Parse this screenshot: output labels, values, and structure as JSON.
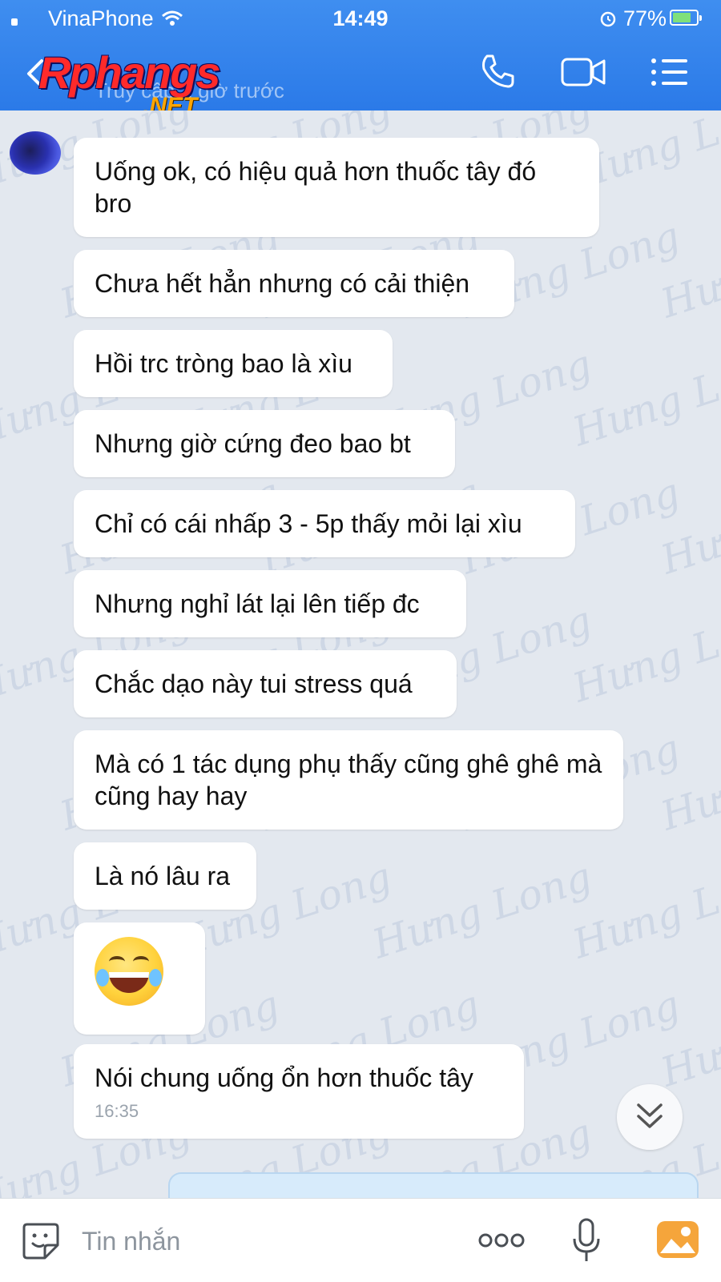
{
  "status_bar": {
    "carrier": "VinaPhone",
    "time": "14:49",
    "battery": "77%",
    "battery_level": 0.77
  },
  "header": {
    "logo_main": "Rphangs",
    "logo_sub": ".NET",
    "subtitle": "Truy cập 1 giờ trước",
    "icons": [
      "back-icon",
      "call-icon",
      "video-call-icon",
      "menu-icon"
    ]
  },
  "messages": [
    {
      "text": "Uống ok, có hiệu quả hơn thuốc tây đó bro"
    },
    {
      "text": "Chưa hết hẳn nhưng có cải thiện"
    },
    {
      "text": "Hồi trc tròng bao là xìu"
    },
    {
      "text": "Nhưng giờ cứng đeo bao bt"
    },
    {
      "text": "Chỉ có cái nhấp 3 - 5p thấy mỏi lại xìu"
    },
    {
      "text": "Nhưng nghỉ lát lại lên tiếp đc"
    },
    {
      "text": "Chắc dạo này tui stress quá"
    },
    {
      "text": "Mà có 1 tác dụng phụ thấy cũng ghê ghê mà cũng hay hay"
    },
    {
      "text": "Là nó lâu ra"
    },
    {
      "emoji": "laughing-tears-emoji"
    },
    {
      "text": "Nói chung uống ổn hơn thuốc tây",
      "time": "16:35"
    }
  ],
  "watermark": "Hưng Long",
  "input": {
    "placeholder": "Tin nhắn"
  },
  "colors": {
    "header": "#2b7ae8",
    "chat_background": "#e3e8ef",
    "bubble": "#ffffff",
    "logo_red": "#ff2a2a",
    "logo_orange": "#ffa500",
    "image_button": "#f5a53b"
  }
}
